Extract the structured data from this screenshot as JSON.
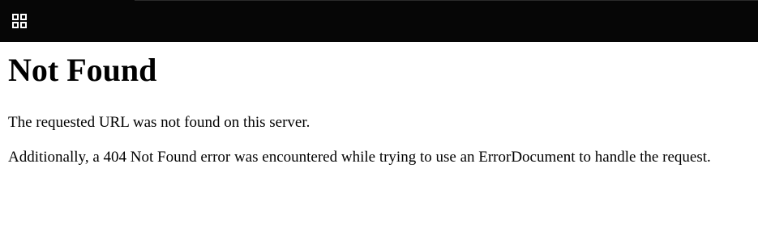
{
  "topbar": {
    "apps_icon": "grid-apps-icon",
    "background": "#060606"
  },
  "page": {
    "title": "Not Found",
    "message": "The requested URL was not found on this server.",
    "detail": "Additionally, a 404 Not Found error was encountered while trying to use an ErrorDocument to handle the request."
  }
}
